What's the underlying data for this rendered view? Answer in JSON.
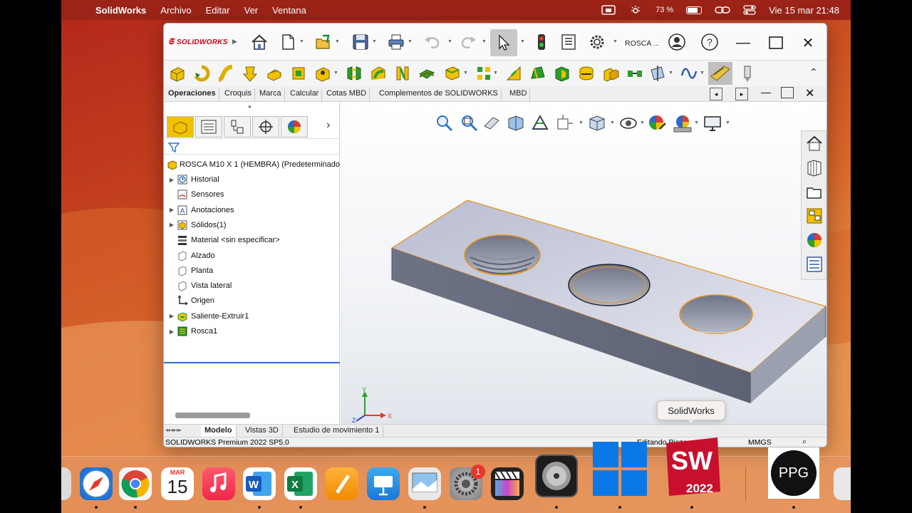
{
  "menubar": {
    "app_name": "SolidWorks",
    "menus": [
      "Archivo",
      "Editar",
      "Ver",
      "Ventana"
    ],
    "battery": "73 %",
    "datetime": "Vie 15 mar  21:48"
  },
  "window": {
    "brand": "SOLIDWORKS",
    "doc_title": "ROSCA ...",
    "command_tabs": [
      "Operaciones",
      "Croquis",
      "Marca",
      "Calcular",
      "Cotas MBD",
      "Complementos de SOLIDWORKS",
      "MBD"
    ],
    "tree_root": "ROSCA M10 X 1 (HEMBRA) (Predeterminado",
    "tree_items": [
      {
        "label": "Historial",
        "expandable": true,
        "icon": "history-icon"
      },
      {
        "label": "Sensores",
        "expandable": false,
        "icon": "sensor-icon"
      },
      {
        "label": "Anotaciones",
        "expandable": true,
        "icon": "annotation-icon"
      },
      {
        "label": "Sólidos(1)",
        "expandable": true,
        "icon": "solid-bodies-icon"
      },
      {
        "label": "Material <sin especificar>",
        "expandable": false,
        "icon": "material-icon"
      },
      {
        "label": "Alzado",
        "expandable": false,
        "icon": "plane-icon"
      },
      {
        "label": "Planta",
        "expandable": false,
        "icon": "plane-icon"
      },
      {
        "label": "Vista lateral",
        "expandable": false,
        "icon": "plane-icon"
      },
      {
        "label": "Origen",
        "expandable": false,
        "icon": "origin-icon"
      },
      {
        "label": "Saliente-Extruir1",
        "expandable": true,
        "icon": "extrude-icon"
      },
      {
        "label": "Rosca1",
        "expandable": true,
        "icon": "thread-icon"
      }
    ],
    "bottom_tabs": [
      "Modelo",
      "Vistas 3D",
      "Estudio de movimiento 1"
    ],
    "status_left": "SOLIDWORKS Premium 2022 SP5.0",
    "status_edit": "Editando Pieza",
    "status_units": "MMGS",
    "triad": {
      "x": "X",
      "y": "Y",
      "z": "Z"
    }
  },
  "tooltip": "SolidWorks",
  "dock": {
    "calendar_month": "MAR",
    "calendar_day": "15",
    "settings_badge": "1",
    "sw_letters": "SW",
    "sw_year": "2022",
    "ppg_label": "PPG"
  },
  "colors": {
    "accent_red": "#d0021b",
    "feature_yellow": "#f2c200",
    "feature_green": "#1e9a34",
    "part_gray": "#9ea3b0"
  }
}
